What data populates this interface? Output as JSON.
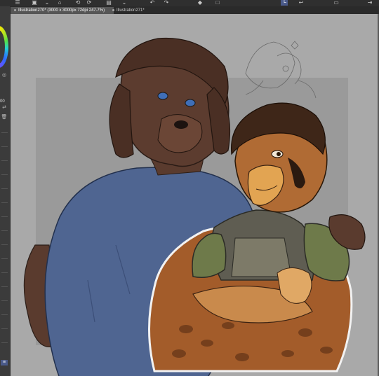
{
  "tabs": [
    {
      "label": "Illustration270* (3000 x 3000px 72dpi 247.7%)",
      "active": true
    },
    {
      "label": "Illustration271*",
      "active": false
    }
  ],
  "left_panel": {
    "size_value": "00"
  },
  "toolbar_icons": [
    "menu-icon",
    "new-file-icon",
    "save-icon",
    "app-icon",
    "undo-icon",
    "redo-icon",
    "clear-icon",
    "transform-icon",
    "fill-icon",
    "selection-icon",
    "lasso-icon",
    "eraser-icon",
    "pen-icon",
    "brush-icon",
    "layer-icon",
    "share-icon"
  ],
  "colors": {
    "accent": "#4a5a8a",
    "canvas_bg": "#a9a9a9",
    "paper": "#9a9a9a",
    "panel": "#3b3b3b"
  }
}
